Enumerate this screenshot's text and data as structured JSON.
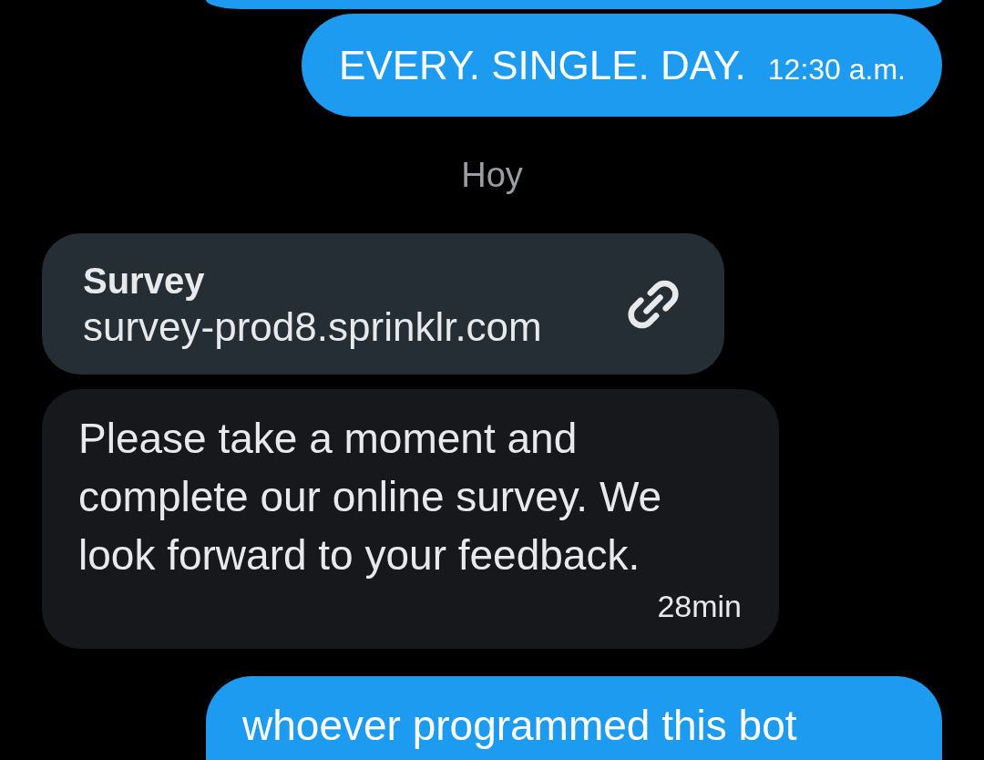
{
  "messages": [
    {
      "kind": "sent-edge"
    },
    {
      "kind": "sent",
      "text": "EVERY. SINGLE. DAY.",
      "time": "12:30 a.m."
    },
    {
      "kind": "date",
      "text": "Hoy"
    },
    {
      "kind": "link",
      "title": "Survey",
      "url": "survey-prod8.sprinklr.com"
    },
    {
      "kind": "received",
      "text": "Please take a moment and complete our online survey. We look forward to your feedback.",
      "time": "28min"
    },
    {
      "kind": "sent",
      "text": "whoever programmed this bot"
    }
  ]
}
